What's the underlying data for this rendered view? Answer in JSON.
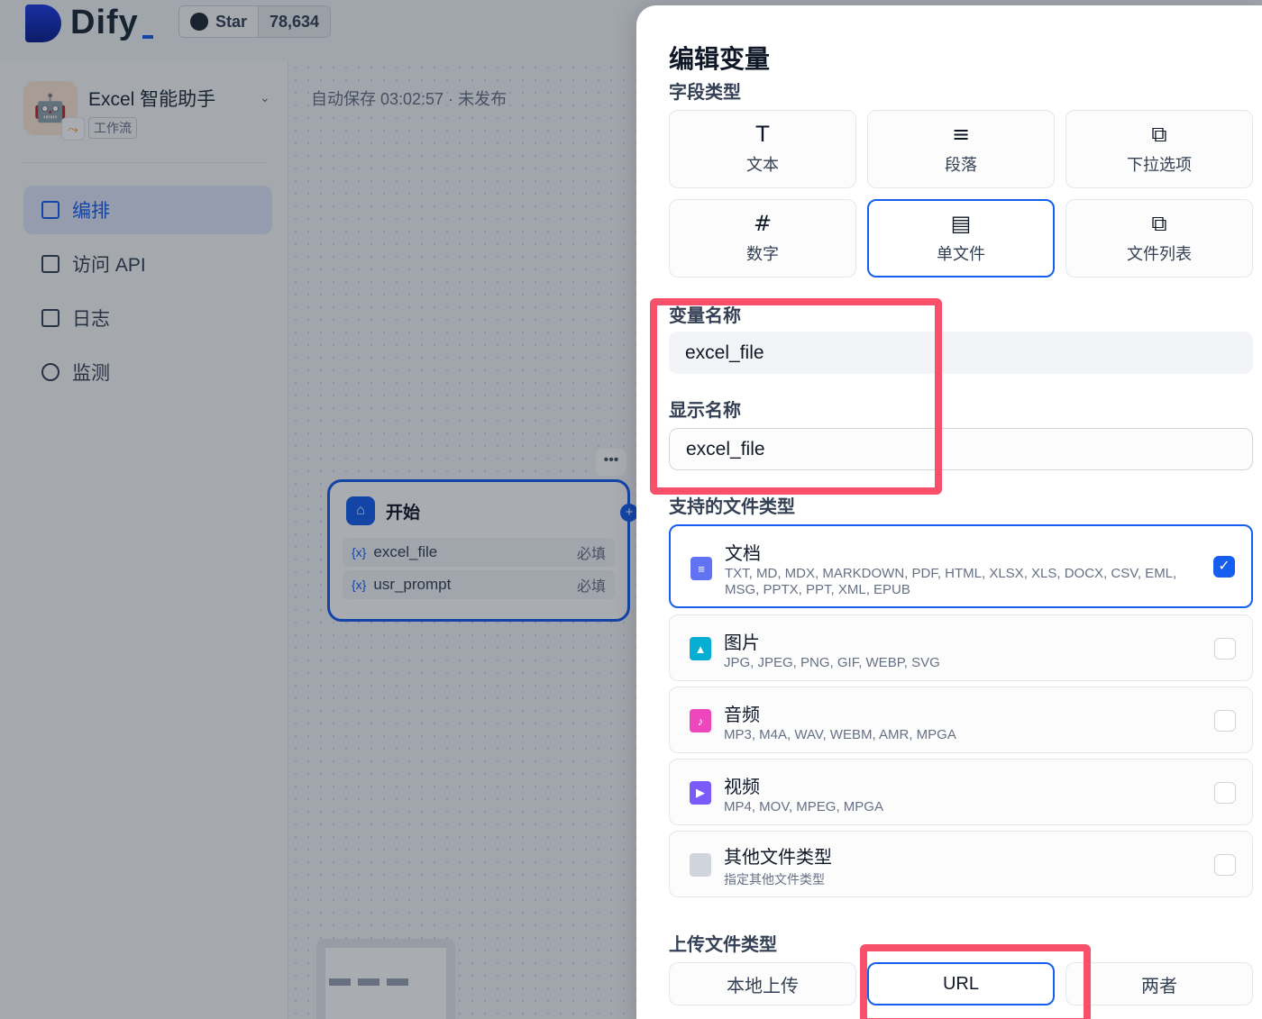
{
  "topbar": {
    "brand": "Dify",
    "github_star_label": "Star",
    "github_star_count": "78,634"
  },
  "sidebar": {
    "app_name": "Excel 智能助手",
    "app_type": "工作流",
    "items": [
      {
        "label": "编排",
        "icon": "layout-icon",
        "active": true
      },
      {
        "label": "访问 API",
        "icon": "terminal-icon",
        "active": false
      },
      {
        "label": "日志",
        "icon": "log-icon",
        "active": false
      },
      {
        "label": "监测",
        "icon": "gauge-icon",
        "active": false
      }
    ]
  },
  "canvas": {
    "autosave": "自动保存 03:02:57 · 未发布",
    "node": {
      "title": "开始",
      "variables": [
        {
          "var_marker": "{x}",
          "name": "excel_file",
          "required": "必填"
        },
        {
          "var_marker": "{x}",
          "name": "usr_prompt",
          "required": "必填"
        }
      ]
    }
  },
  "modal": {
    "title": "编辑变量",
    "field_type_label": "字段类型",
    "field_types": [
      {
        "label": "文本",
        "icon": "text-box-icon",
        "glyph": "T",
        "selected": false
      },
      {
        "label": "段落",
        "icon": "paragraph-icon",
        "glyph": "≡",
        "selected": false
      },
      {
        "label": "下拉选项",
        "icon": "select-options-icon",
        "glyph": "⧉",
        "selected": false
      },
      {
        "label": "数字",
        "icon": "hash-icon",
        "glyph": "#",
        "selected": false
      },
      {
        "label": "单文件",
        "icon": "file-icon",
        "glyph": "▤",
        "selected": true
      },
      {
        "label": "文件列表",
        "icon": "file-list-icon",
        "glyph": "⧉",
        "selected": false
      }
    ],
    "var_name_label": "变量名称",
    "var_name_value": "excel_file",
    "display_name_label": "显示名称",
    "display_name_value": "excel_file",
    "supported_types_label": "支持的文件类型",
    "file_types": [
      {
        "name": "文档",
        "desc": "TXT, MD, MDX, MARKDOWN, PDF, HTML, XLSX, XLS, DOCX, CSV, EML, MSG, PPTX, PPT, XML, EPUB",
        "checked": true,
        "icon": "document-icon",
        "color": "#6172f3"
      },
      {
        "name": "图片",
        "desc": "JPG, JPEG, PNG, GIF, WEBP, SVG",
        "checked": false,
        "icon": "image-icon",
        "color": "#06aed4"
      },
      {
        "name": "音频",
        "desc": "MP3, M4A, WAV, WEBM, AMR, MPGA",
        "checked": false,
        "icon": "audio-icon",
        "color": "#ee46bc"
      },
      {
        "name": "视频",
        "desc": "MP4, MOV, MPEG, MPGA",
        "checked": false,
        "icon": "video-icon",
        "color": "#7a5af8"
      },
      {
        "name": "其他文件类型",
        "desc": "指定其他文件类型",
        "checked": false,
        "icon": "other-file-icon",
        "color": "#d0d5dd"
      }
    ],
    "upload_type_label": "上传文件类型",
    "upload_types": [
      {
        "label": "本地上传",
        "selected": false
      },
      {
        "label": "URL",
        "selected": true
      },
      {
        "label": "两者",
        "selected": false
      }
    ]
  },
  "colors": {
    "accent": "#155eef",
    "highlight": "#f8506a"
  }
}
